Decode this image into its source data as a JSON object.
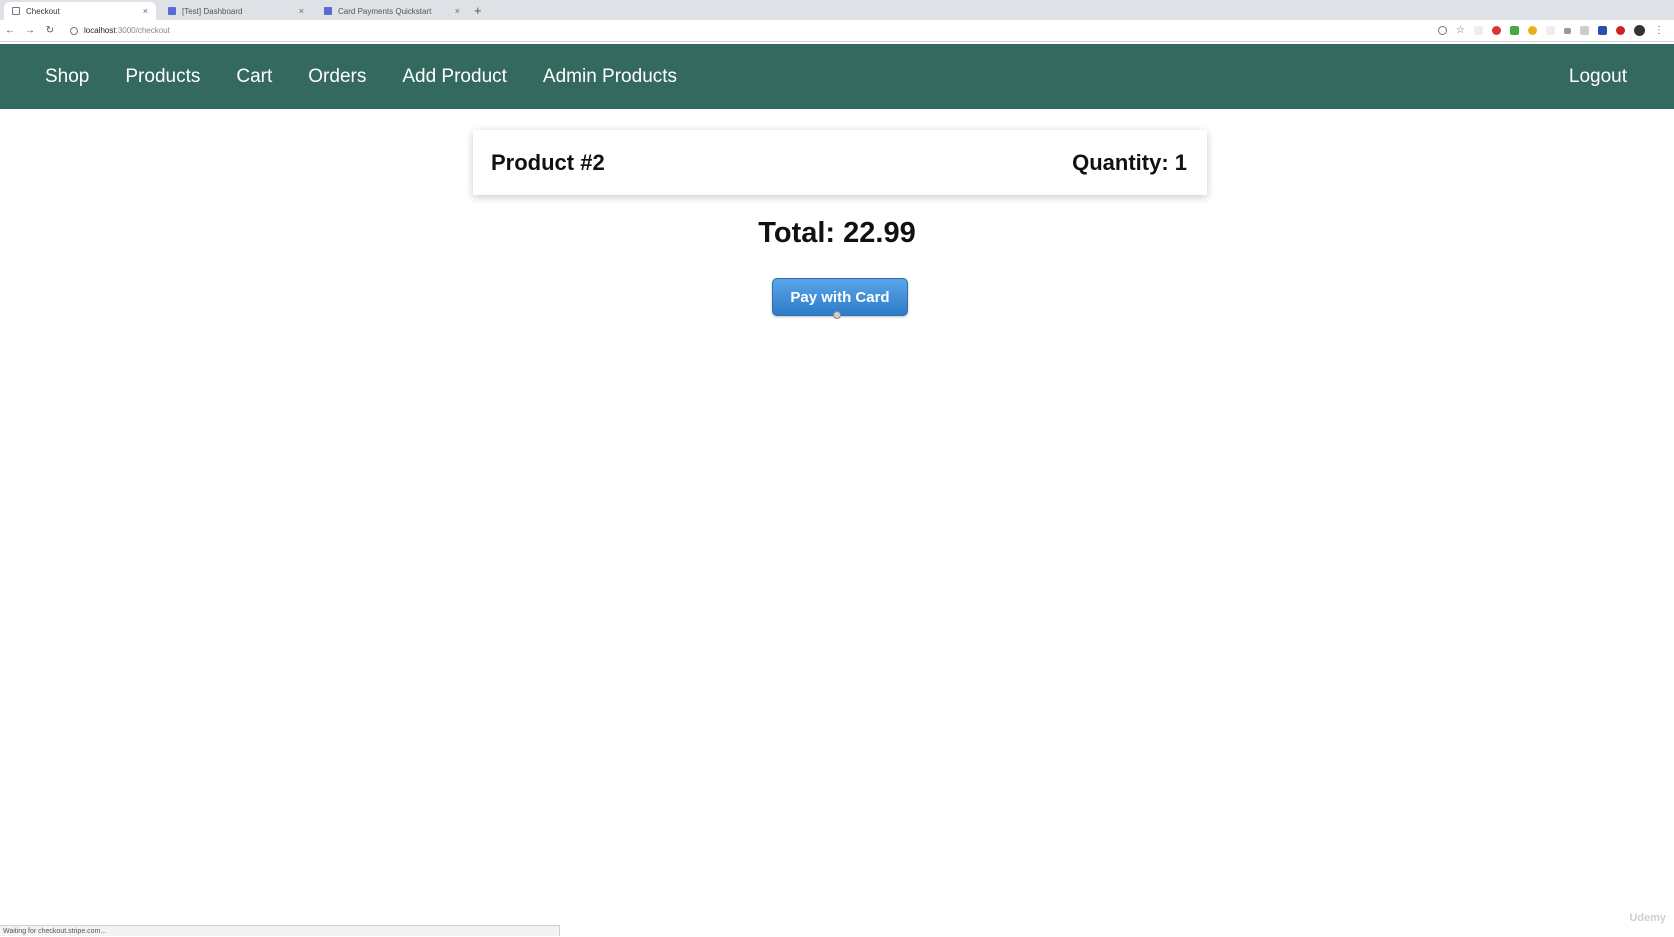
{
  "browser": {
    "tabs": [
      {
        "title": "Checkout",
        "active": true,
        "icon": "page-icon"
      },
      {
        "title": "[Test] Dashboard",
        "active": false,
        "icon": "stripe-icon"
      },
      {
        "title": "Card Payments Quickstart",
        "active": false,
        "icon": "stripe-icon"
      }
    ],
    "new_tab": "+",
    "url_host": "localhost",
    "url_path": ":3000/checkout",
    "status_text": "Waiting for checkout.stripe.com..."
  },
  "nav": {
    "items": [
      "Shop",
      "Products",
      "Cart",
      "Orders",
      "Add Product",
      "Admin Products"
    ],
    "logout": "Logout",
    "background": "#33695e"
  },
  "checkout": {
    "product_title": "Product #2",
    "quantity": "Quantity: 1",
    "total": "Total: 22.99",
    "pay_button": "Pay with Card",
    "button_color": "#3a8ad8"
  },
  "watermark": "Udemy"
}
